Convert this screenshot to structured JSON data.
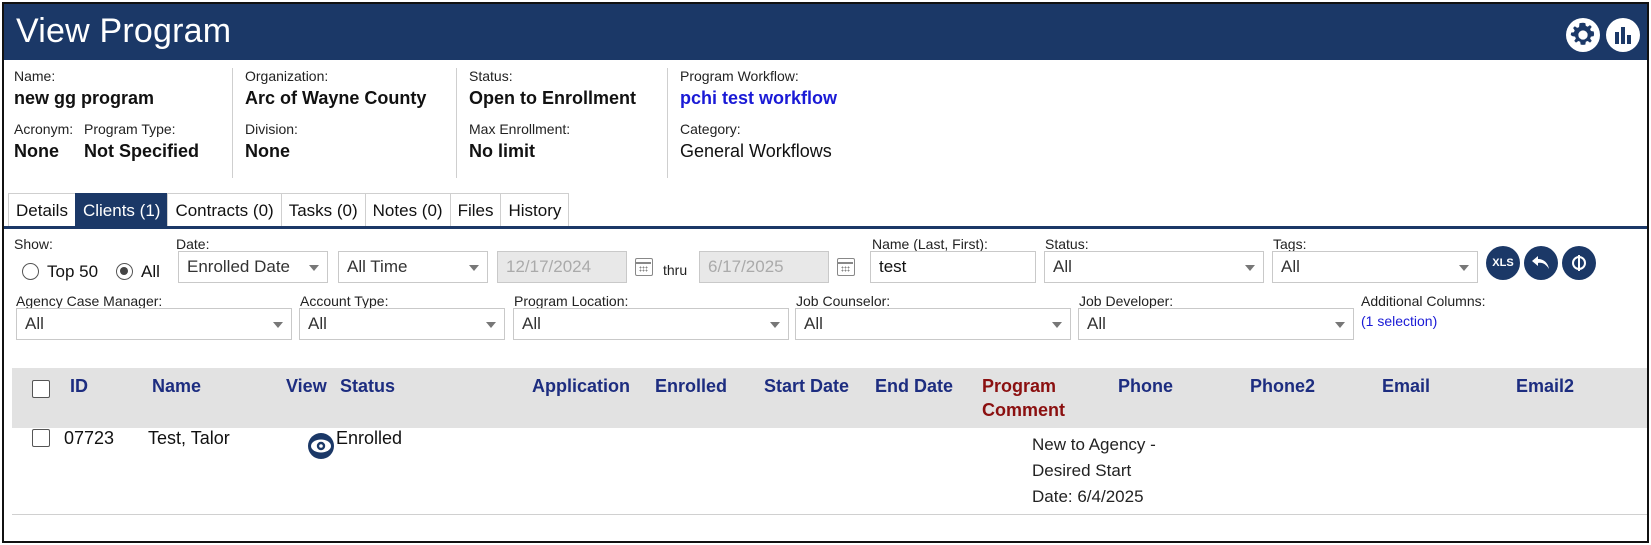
{
  "header": {
    "title": "View Program",
    "icons": [
      "gear-icon",
      "chart-icon"
    ]
  },
  "info": {
    "name_label": "Name:",
    "name": "new gg program",
    "acronym_label": "Acronym:",
    "acronym": "None",
    "program_type_label": "Program Type:",
    "program_type": "Not Specified",
    "organization_label": "Organization:",
    "organization": "Arc of Wayne County",
    "division_label": "Division:",
    "division": "None",
    "status_label": "Status:",
    "status": "Open to Enrollment",
    "max_enrollment_label": "Max Enrollment:",
    "max_enrollment": "No limit",
    "workflow_label": "Program Workflow:",
    "workflow": "pchi test workflow",
    "category_label": "Category:",
    "category": "General Workflows"
  },
  "tabs": [
    {
      "label": "Details",
      "active": false
    },
    {
      "label": "Clients (1)",
      "active": true
    },
    {
      "label": "Contracts (0)",
      "active": false
    },
    {
      "label": "Tasks (0)",
      "active": false
    },
    {
      "label": "Notes (0)",
      "active": false
    },
    {
      "label": "Files",
      "active": false
    },
    {
      "label": "History",
      "active": false
    }
  ],
  "filters": {
    "show_label": "Show:",
    "top50_label": "Top 50",
    "all_label": "All",
    "show_selected": "All",
    "date_label": "Date:",
    "date_type": "Enrolled Date",
    "date_range": "All Time",
    "date_from": "12/17/2024",
    "thru_label": "thru",
    "date_to": "6/17/2025",
    "name_label": "Name (Last, First):",
    "name_value": "test",
    "status_label": "Status:",
    "status_value": "All",
    "tags_label": "Tags:",
    "tags_value": "All",
    "xls_label": "XLS",
    "agency_cm_label": "Agency Case Manager:",
    "agency_cm_value": "All",
    "account_type_label": "Account Type:",
    "account_type_value": "All",
    "location_label": "Program Location:",
    "location_value": "All",
    "job_counselor_label": "Job Counselor:",
    "job_counselor_value": "All",
    "job_developer_label": "Job Developer:",
    "job_developer_value": "All",
    "additional_label": "Additional Columns:",
    "additional_value": "(1 selection)"
  },
  "grid": {
    "columns": {
      "id": "ID",
      "name": "Name",
      "view": "View",
      "status": "Status",
      "application": "Application",
      "enrolled": "Enrolled",
      "start_date": "Start Date",
      "end_date": "End Date",
      "program_comment": "Program Comment",
      "phone": "Phone",
      "phone2": "Phone2",
      "email": "Email",
      "email2": "Email2"
    },
    "rows": [
      {
        "id": "07723",
        "name": "Test, Talor",
        "status": "Enrolled",
        "program_comment": "New to Agency - Desired Start Date: 6/4/2025"
      }
    ]
  },
  "colors": {
    "primary": "#1b3867",
    "link": "#1a1ad6",
    "header_text": "#1d2d80",
    "comment_header": "#8b1010"
  }
}
